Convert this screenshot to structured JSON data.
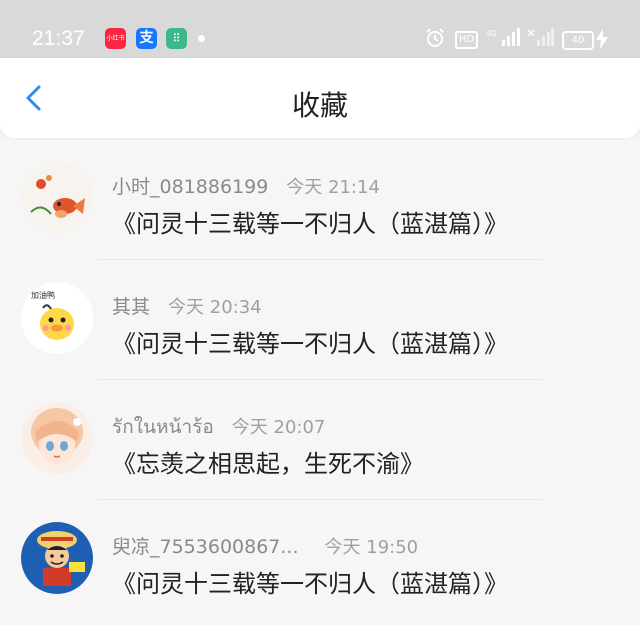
{
  "status_bar": {
    "time": "21:37",
    "app_icons": [
      {
        "name": "xiaohongshu-icon",
        "label": "小红书"
      },
      {
        "name": "alipay-icon",
        "label": "支"
      },
      {
        "name": "green-app-icon",
        "label": "⠿"
      }
    ],
    "hd_label": "HD",
    "network_label": "4G",
    "battery_level": "40"
  },
  "header": {
    "title": "收藏",
    "back_icon": "chevron-left-icon"
  },
  "colors": {
    "accent": "#2e8ff0",
    "status_bar_bg": "#d9d9d9",
    "page_bg": "#f6f6f6"
  },
  "favorites": [
    {
      "username": "小时_081886199",
      "time": "今天 21:14",
      "title": "《问灵十三载等一不归人（蓝湛篇）》"
    },
    {
      "username": "其其",
      "time": "今天 20:34",
      "title": "《问灵十三载等一不归人（蓝湛篇）》"
    },
    {
      "username": "รักในหน้าร้อ",
      "time": "今天 20:07",
      "title": "《忘羡之相思起，生死不渝》"
    },
    {
      "username": "臾凉_7553600867...",
      "time": "今天 19:50",
      "title": "《问灵十三载等一不归人（蓝湛篇）》"
    }
  ]
}
